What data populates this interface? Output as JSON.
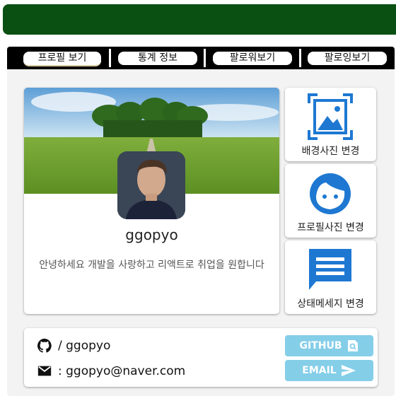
{
  "tabs": [
    "프로필 보기",
    "통계 정보",
    "팔로워보기",
    "팔로잉보기"
  ],
  "profile": {
    "username": "ggopyo",
    "bio": "안녕하세요 개발을 사랑하고 리액트로 취업을 원합니다"
  },
  "actions": {
    "change_background": "배경사진 변경",
    "change_profile_photo": "프로필사진 변경",
    "change_status": "상태메세지 변경"
  },
  "contact": {
    "github": "/ ggopyo",
    "email": ": ggopyo@naver.com",
    "github_button": "GITHUB",
    "email_button": "EMAIL"
  },
  "colors": {
    "header": "#0a5012",
    "icon_blue": "#1e78d2",
    "button_blue": "#84cee8"
  }
}
